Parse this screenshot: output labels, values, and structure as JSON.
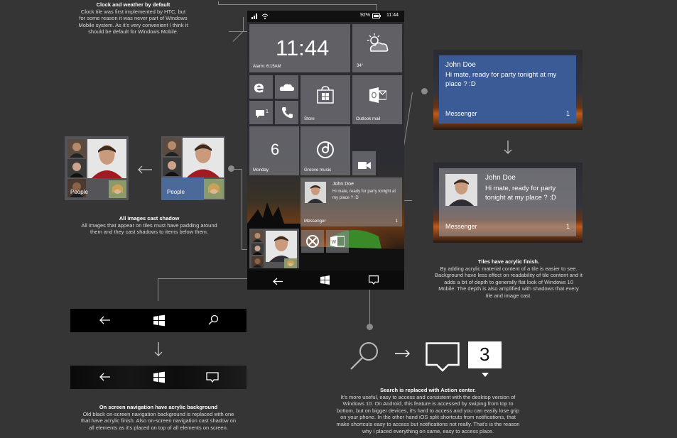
{
  "notes": {
    "clock": {
      "title": "Clock and weather by default",
      "body": "Clock tile was first implemented by HTC, but for some reason it was never part of Windows Mobile system. As it's very convenient I think it should be default for Windows Mobile."
    },
    "images": {
      "title": "All images cast shadow",
      "body": "All images that appear on tiles must have padding around them and they cast shadows to items below them."
    },
    "tiles": {
      "title": "Tiles have acrylic finish.",
      "body": "By adding acrylic material content of a tile is easier to see. Background have less effect on readability of tile content and it adds a bit of depth to generally flat look of Windows 10 Mobile. The depth is also amplified with shadows that every tile and image cast."
    },
    "nav": {
      "title": "On screen navigation have acrylic background",
      "body": "Old black on-screen navigation background is replaced with one that have acrylic finish. Also on-screen navigation cast shadow on all elements as it's placed on top of all elements on screen."
    },
    "search": {
      "title": "Search is replaced with Action center.",
      "body": "It's more useful, easy to access and consistent with the desktop version of Windows 10. On Android, this feature is accessed by swiping from top to bottom, but on bigger devices, it's hard to access and you can easily lose grip on your phone. In the other hand iOS split shortcuts from notifications, that make shortcuts easy to access but notifications not really. That's is the reason why I placed everything on same, easy to access place."
    }
  },
  "phone": {
    "status": {
      "battery": "92%",
      "time": "11:44"
    },
    "clock_tile": {
      "time": "11:44",
      "alarm": "Alarm: 6:15AM"
    },
    "weather_tile": {
      "temp": "34°",
      "icon": "partly-cloudy-icon"
    },
    "store_tile": {
      "label": "Store"
    },
    "outlook_tile": {
      "label": "Outlook mail"
    },
    "messaging_tile": {
      "count": "1"
    },
    "calendar_tile": {
      "day": "6",
      "label": "Monday"
    },
    "groove_tile": {
      "label": "Groove music"
    },
    "messenger_tile": {
      "name": "John Doe",
      "message": "Hi mate, ready for party tonight at my place ? :D",
      "app": "Messenger",
      "count": "1"
    }
  },
  "people": {
    "before_label": "People",
    "after_label": "People"
  },
  "cards": {
    "top": {
      "name": "John Doe",
      "message": "Hi mate, ready for party tonight at my place ? :D",
      "app": "Messenger",
      "count": "1"
    },
    "bottom": {
      "name": "John Doe",
      "message": "Hi mate, ready for party tonight at my place ? :D",
      "app": "Messenger",
      "count": "1"
    }
  },
  "action_center": {
    "badge": "3"
  },
  "colors": {
    "card_blue": "#3a5b95",
    "background": "#353535",
    "navbar": "#0d0d0d"
  }
}
